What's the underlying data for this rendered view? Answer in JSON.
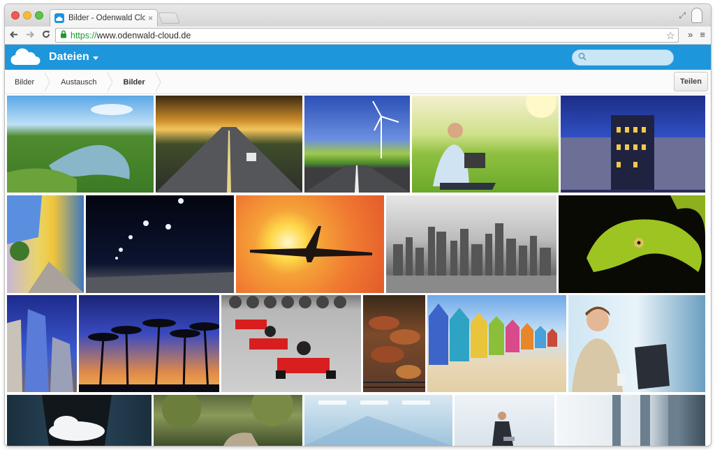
{
  "browser": {
    "tab_title": "Bilder - Odenwald Cloud",
    "tab_close": "×",
    "url_scheme": "https://",
    "url_host": "www.odenwald-cloud.de",
    "overflow_label": "»",
    "menu_label": "≡",
    "restore_label": "⤢"
  },
  "app": {
    "section_title": "Dateien",
    "search_placeholder": "",
    "brand_color": "#1d96db"
  },
  "breadcrumb": {
    "items": [
      "Bilder",
      "Austausch",
      "Bilder"
    ]
  },
  "toolbar": {
    "share_label": "Teilen"
  },
  "gallery": {
    "photos": [
      {
        "name": "photo-river-valley",
        "row": 0
      },
      {
        "name": "photo-highway-sunset",
        "row": 0
      },
      {
        "name": "photo-wind-turbine-road",
        "row": 0
      },
      {
        "name": "photo-man-laptop-meadow",
        "row": 0
      },
      {
        "name": "photo-palace-night",
        "row": 0
      },
      {
        "name": "photo-colorful-street",
        "row": 1
      },
      {
        "name": "photo-night-streetlights",
        "row": 1
      },
      {
        "name": "photo-airplane-sun",
        "row": 1
      },
      {
        "name": "photo-city-skyline-bw",
        "row": 1
      },
      {
        "name": "photo-green-snake",
        "row": 1
      },
      {
        "name": "photo-skyscrapers-blue",
        "row": 2
      },
      {
        "name": "photo-palm-trees-sunset",
        "row": 2
      },
      {
        "name": "photo-go-karts",
        "row": 2
      },
      {
        "name": "photo-grilled-food",
        "row": 2
      },
      {
        "name": "photo-beach-huts",
        "row": 2
      },
      {
        "name": "photo-woman-office-laptop",
        "row": 2
      },
      {
        "name": "photo-hand-cloud",
        "row": 3
      },
      {
        "name": "photo-green-park",
        "row": 3
      },
      {
        "name": "photo-office-interior",
        "row": 3
      },
      {
        "name": "photo-businessman-white",
        "row": 3
      },
      {
        "name": "photo-window-light",
        "row": 3
      }
    ]
  }
}
